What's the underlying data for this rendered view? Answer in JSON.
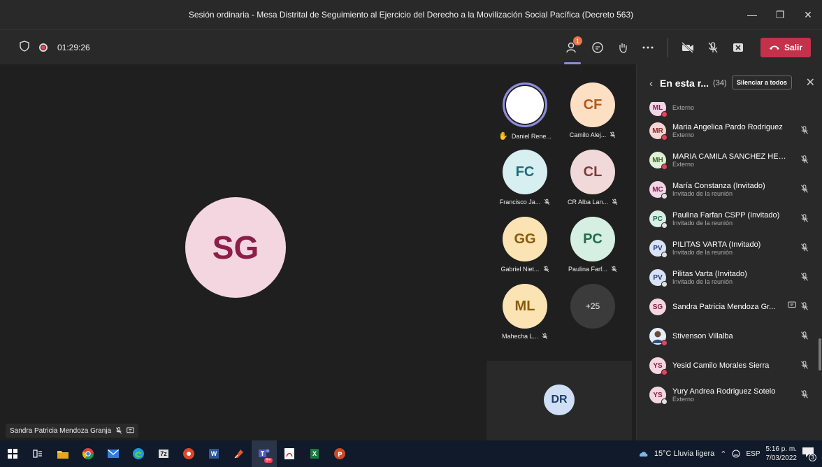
{
  "window": {
    "title": "Sesión ordinaria - Mesa Distrital de Seguimiento al Ejercicio del Derecho a la Movilización Social Pacífica (Decreto 563)",
    "minimize": "—",
    "maximize": "❐",
    "close": "✕"
  },
  "toolbar": {
    "timer": "01:29:26",
    "participants_badge": "1",
    "leave_label": "Salir"
  },
  "stage": {
    "speaker_initials": "SG",
    "speaker_name": "Sandra Patricia Mendoza Granja"
  },
  "gallery": {
    "tiles": [
      {
        "initials": "",
        "label": "Daniel Rene..."
      },
      {
        "initials": "CF",
        "label": "Camilo Alej..."
      },
      {
        "initials": "FC",
        "label": "Francisco Ja..."
      },
      {
        "initials": "CL",
        "label": "CR Alba Lan..."
      },
      {
        "initials": "GG",
        "label": "Gabriel Niet..."
      },
      {
        "initials": "PC",
        "label": "Paulina Farf..."
      },
      {
        "initials": "ML",
        "label": "Mahecha L..."
      },
      {
        "initials": "+25",
        "label": ""
      }
    ],
    "bottom_initials": "DR"
  },
  "panel": {
    "title": "En esta r...",
    "count": "(34)",
    "mute_all": "Silenciar a todos",
    "participants": [
      {
        "initials": "ML",
        "name": "",
        "sub": "Externo"
      },
      {
        "initials": "MR",
        "name": "Maria Angelica Pardo Rodriguez",
        "sub": "Externo"
      },
      {
        "initials": "MH",
        "name": "MARIA CAMILA SANCHEZ HER...",
        "sub": "Externo"
      },
      {
        "initials": "MC",
        "name": "María Constanza (Invitado)",
        "sub": "Invitado de la reunión"
      },
      {
        "initials": "PC",
        "name": "Paulina Farfan CSPP (Invitado)",
        "sub": "Invitado de la reunión"
      },
      {
        "initials": "PV",
        "name": "PILITAS VARTA (Invitado)",
        "sub": "Invitado de la reunión"
      },
      {
        "initials": "PV",
        "name": "Pilitas Varta (Invitado)",
        "sub": "Invitado de la reunión"
      },
      {
        "initials": "SG",
        "name": "Sandra Patricia Mendoza Gr...",
        "sub": ""
      },
      {
        "initials": "",
        "name": "Stivenson Villalba",
        "sub": ""
      },
      {
        "initials": "YS",
        "name": "Yesid Camilo Morales Sierra",
        "sub": ""
      },
      {
        "initials": "YS",
        "name": "Yury Andrea Rodriguez Sotelo",
        "sub": "Externo"
      }
    ]
  },
  "taskbar": {
    "teams_badge": "9+",
    "weather": "15°C  Lluvia ligera",
    "lang": "ESP",
    "time": "5:16 p. m.",
    "date": "7/03/2022",
    "notif_count": "3"
  },
  "colors": {
    "leave": "#c4314b",
    "accent": "#8b8cdf",
    "badge": "#e97548"
  }
}
